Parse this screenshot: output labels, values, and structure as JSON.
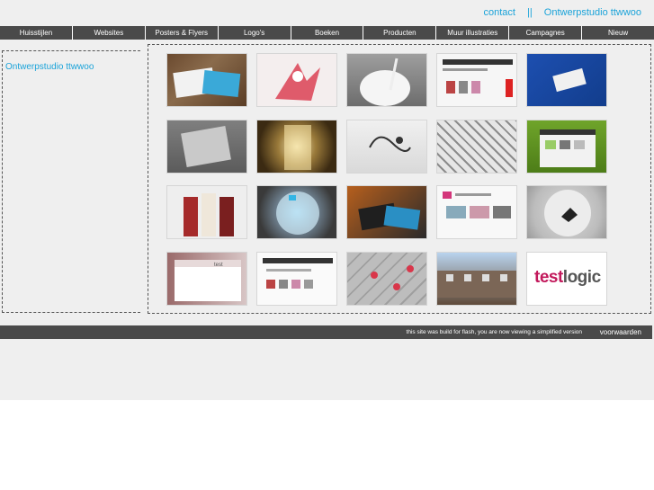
{
  "header": {
    "contact_label": "contact",
    "separator": "||",
    "brand_label": "Ontwerpstudio ttwwoo"
  },
  "nav": {
    "items": [
      {
        "label": "Huisstijlen"
      },
      {
        "label": "Websites"
      },
      {
        "label": "Posters & Flyers"
      },
      {
        "label": "Logo's"
      },
      {
        "label": "Boeken"
      },
      {
        "label": "Producten"
      },
      {
        "label": "Muur illustraties"
      },
      {
        "label": "Campagnes"
      },
      {
        "label": "Nieuw"
      }
    ]
  },
  "sidebar": {
    "link_label": "Ontwerpstudio ttwwoo"
  },
  "gallery": {
    "last_logo": {
      "part1": "test",
      "part2": "logic"
    }
  },
  "footer": {
    "notice": "this site was build for flash, you are now viewing a simplified version",
    "terms_label": "voorwaarden"
  },
  "colors": {
    "accent": "#1aa3d9",
    "bar": "#4a4a4a",
    "background": "#efefef"
  }
}
